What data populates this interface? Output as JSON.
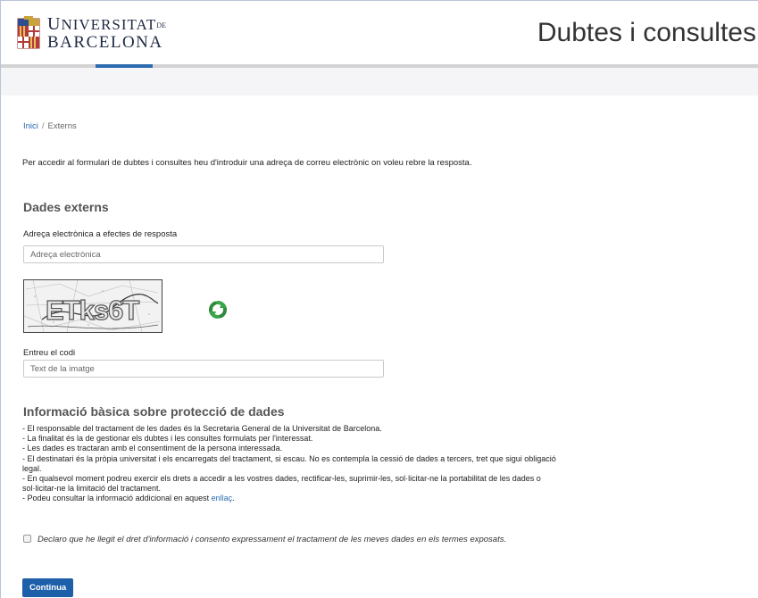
{
  "header": {
    "logo_line1_u": "U",
    "logo_line1_rest": "NIVERSITAT",
    "logo_line1_de": "DE",
    "logo_line2": "BARCELONA",
    "site_title": "Dubtes i consultes"
  },
  "breadcrumb": {
    "home": "Inici",
    "separator": "/",
    "current": "Externs"
  },
  "intro_text": "Per accedir al formulari de dubtes i consultes heu d'introduir una adreça de correu electrònic on voleu rebre la resposta.",
  "form": {
    "section_title": "Dades externs",
    "email_label": "Adreça electrònica a efectes de resposta",
    "email_placeholder": "Adreça electrònica",
    "email_value": "",
    "captcha_text": "ETks6T",
    "code_label": "Entreu el codi",
    "code_placeholder": "Text de la imatge",
    "code_value": ""
  },
  "info": {
    "title": "Informació bàsica sobre protecció de dades",
    "lines": [
      "- El responsable del tractament de les dades és la Secretaria General de la Universitat de Barcelona.",
      "- La finalitat és la de gestionar els dubtes i les consultes formulats per l'interessat.",
      "- Les dades es tractaran amb el consentiment de la persona interessada.",
      "- El destinatari és la pròpia universitat i els encarregats del tractament, si escau. No es contempla la cessió de dades a tercers, tret que sigui obligació",
      "legal.",
      "- En qualsevol moment podreu exercir els drets a accedir a les vostres dades, rectificar-les, suprimir-les, sol·licitar-ne la portabilitat de les dades o",
      "sol·licitar-ne la limitació del tractament."
    ],
    "last_line_prefix": "- Podeu consultar la informació addicional en aquest",
    "link_text": "enllaç",
    "last_line_suffix": "."
  },
  "consent": {
    "checked": false,
    "text": "Declaro que he llegit el dret d'informació i consento expressament el tractament de les meves dades en els termes exposats."
  },
  "submit_label": "Continua",
  "colors": {
    "accent": "#2b6cb0",
    "button": "#1d5fa9",
    "refresh_green": "#3aa54a"
  },
  "icons": {
    "logo": "university-shield-icon",
    "refresh": "refresh-icon"
  }
}
